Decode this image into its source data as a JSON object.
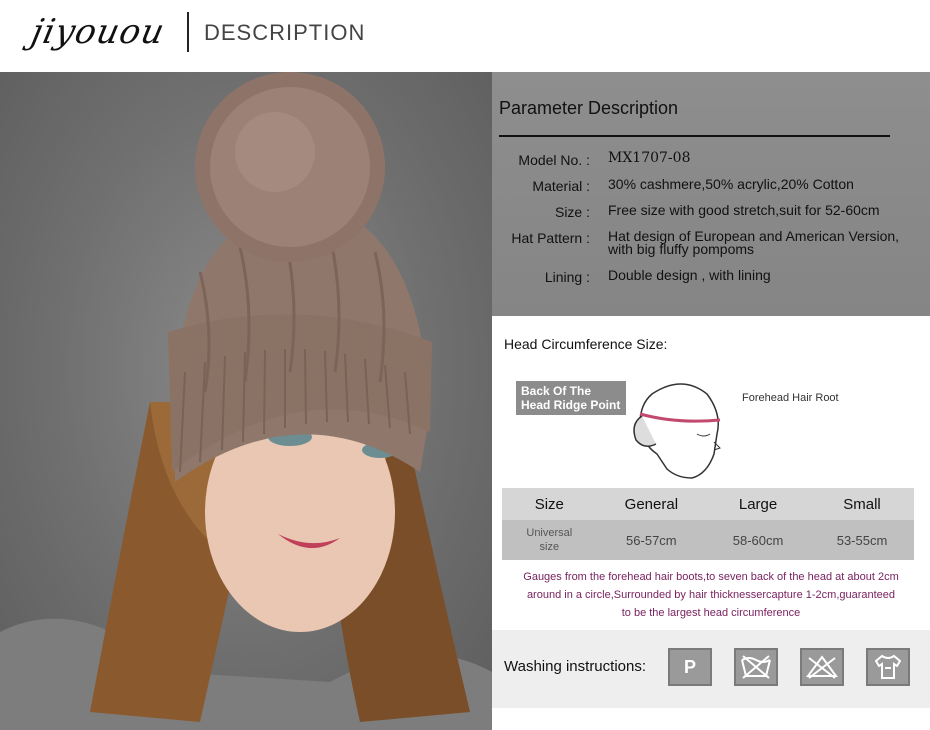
{
  "header": {
    "logo_text": "jiyouou",
    "title": "DESCRIPTION"
  },
  "parameters": {
    "title": "Parameter Description",
    "rows": [
      {
        "label": "Model No. :",
        "value": "MX1707-08"
      },
      {
        "label": "Material :",
        "value": "30% cashmere,50% acrylic,20% Cotton"
      },
      {
        "label": "Size :",
        "value": "Free size with good stretch,suit for 52-60cm"
      },
      {
        "label": "Hat Pattern :",
        "value": "Hat design of European and American Version, with big fluffy pompoms"
      },
      {
        "label": "Lining :",
        "value": "Double design , with lining"
      }
    ]
  },
  "head_size": {
    "title": "Head Circumference Size:",
    "tag_line1": "Back Of The",
    "tag_line2": "Head Ridge Point",
    "forehead_label": "Forehead Hair Root",
    "table": {
      "headers": [
        "Size",
        "General",
        "Large",
        "Small"
      ],
      "row_label_line1": "Universal",
      "row_label_line2": "size",
      "values": [
        "56-57cm",
        "58-60cm",
        "53-55cm"
      ]
    },
    "gauge_note_lines": [
      "Gauges from the forehead hair boots,to seven back of the head at about 2cm",
      "around in a circle,Surrounded by hair thicknessercapture 1-2cm,guaranteed",
      "to be the largest head circumference"
    ]
  },
  "washing": {
    "label": "Washing instructions:",
    "icons": [
      {
        "name": "dry-clean-p-icon",
        "glyph": "P"
      },
      {
        "name": "no-machine-wash-icon",
        "glyph": ""
      },
      {
        "name": "no-bleach-icon",
        "glyph": ""
      },
      {
        "name": "hand-wash-shirt-icon",
        "glyph": ""
      }
    ]
  }
}
